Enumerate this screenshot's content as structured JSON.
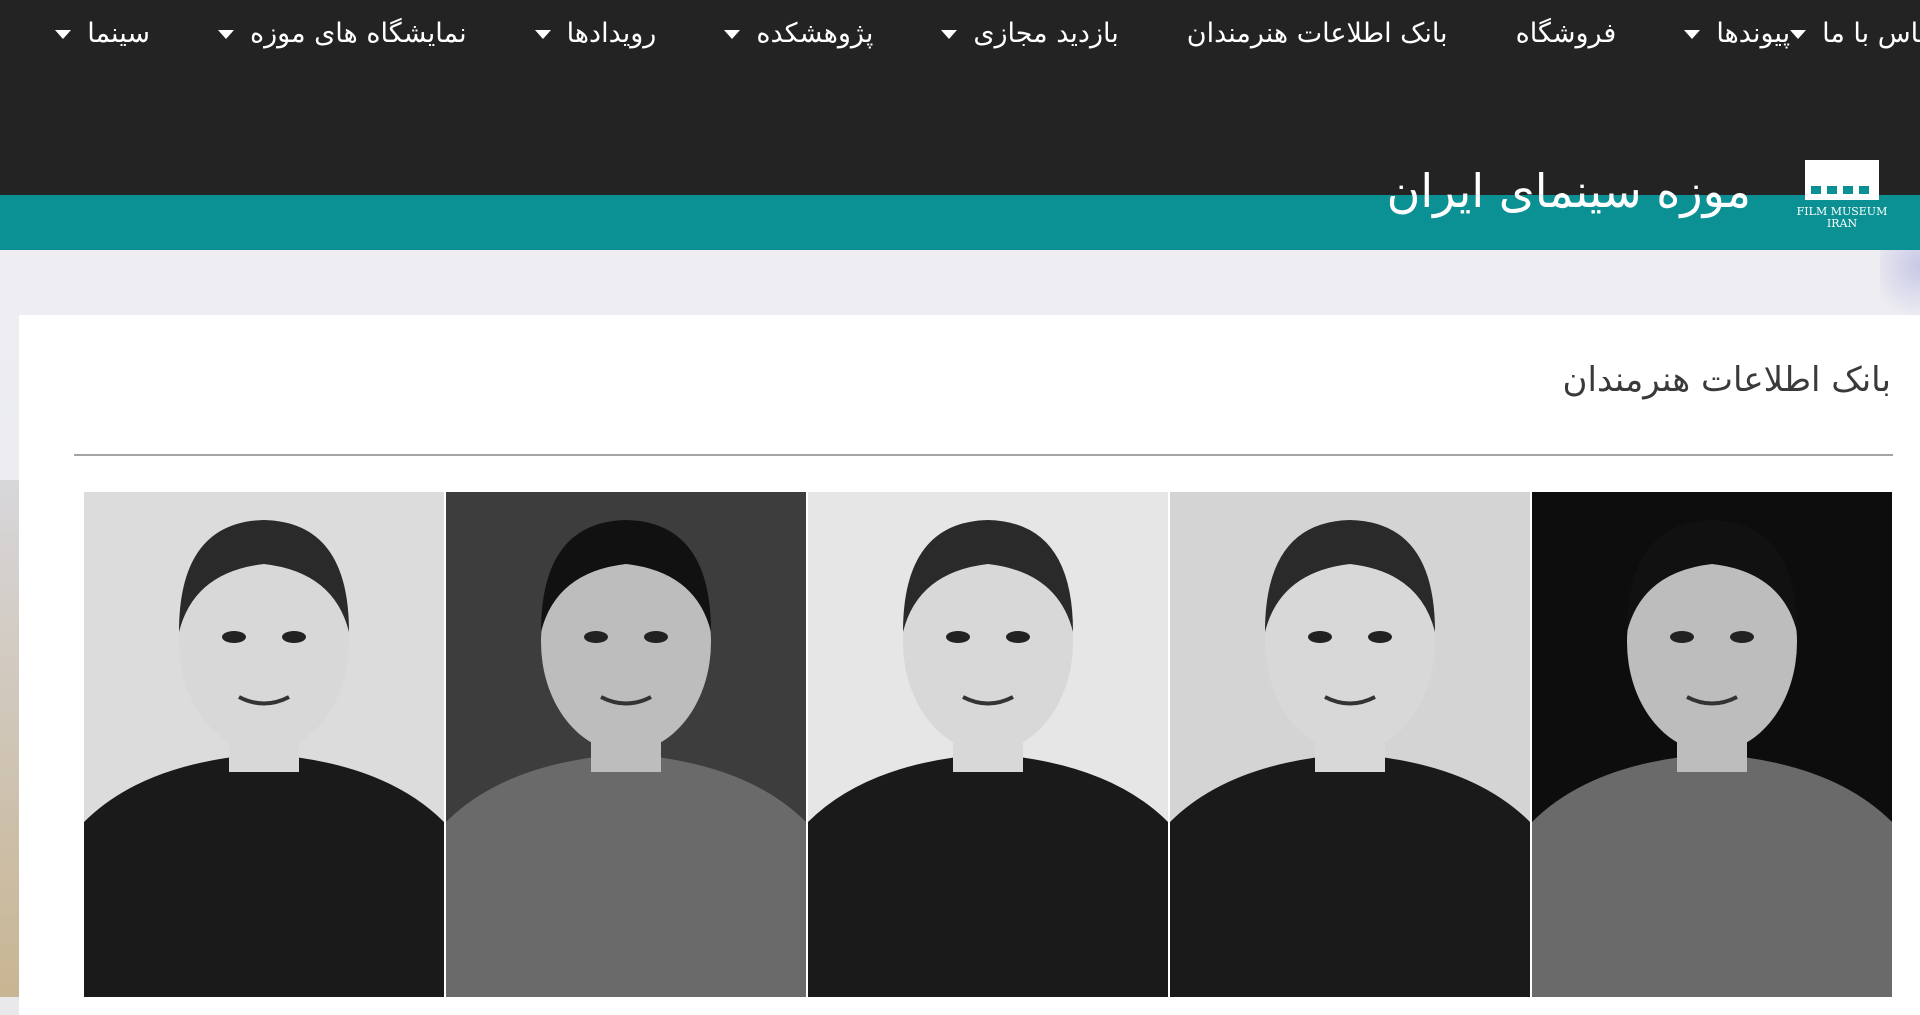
{
  "nav": {
    "items": [
      {
        "label": "سینما",
        "dropdown": true
      },
      {
        "label": "نمایشگاه های موزه",
        "dropdown": true
      },
      {
        "label": "رویدادها",
        "dropdown": true
      },
      {
        "label": "پژوهشکده",
        "dropdown": true
      },
      {
        "label": "بازدید مجازی",
        "dropdown": true
      },
      {
        "label": "بانک اطلاعات هنرمندان",
        "dropdown": false
      },
      {
        "label": "فروشگاه",
        "dropdown": false
      },
      {
        "label": "پیوندها",
        "dropdown": true
      },
      {
        "label": "تماس با ما",
        "dropdown": true
      }
    ]
  },
  "logo": {
    "script_text": "موزه سینمای ایران",
    "line1": "FILM MUSEUM",
    "line2": "IRAN"
  },
  "page": {
    "title": "بانک اطلاعات هنرمندان"
  },
  "gallery": {
    "items": [
      {
        "name": "portrait-man-bowtie",
        "bg": "#dcdcdc",
        "dark": false
      },
      {
        "name": "portrait-young-man-suit",
        "bg": "#3d3d3d",
        "dark": true
      },
      {
        "name": "portrait-man-sunglasses",
        "bg": "#e6e6e6",
        "dark": false
      },
      {
        "name": "portrait-smiling-bearded-man",
        "bg": "#d4d4d4",
        "dark": false
      },
      {
        "name": "portrait-man-shadow",
        "bg": "#0d0d0d",
        "dark": true
      }
    ]
  },
  "colors": {
    "nav_bg": "#232323",
    "accent_teal": "#0b9193",
    "page_bg": "#e9e9ec",
    "card_bg": "#ffffff"
  }
}
